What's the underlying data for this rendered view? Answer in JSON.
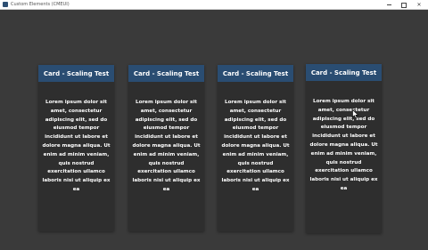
{
  "window": {
    "title": "Custom Elements (CMEUI)"
  },
  "cards": [
    {
      "header": "Card - Scaling Test",
      "body": "Lorem ipsum dolor sit amet, consectetur adipiscing elit, sed do eiusmod tempor incididunt ut labore et dolore magna aliqua. Ut enim ad minim veniam, quis nostrud exercitation ullamco laboris nisi ut aliquip ex ea"
    },
    {
      "header": "Card - Scaling Test",
      "body": "Lorem ipsum dolor sit amet, consectetur adipiscing elit, sed do eiusmod tempor incididunt ut labore et dolore magna aliqua. Ut enim ad minim veniam, quis nostrud exercitation ullamco laboris nisi ut aliquip ex ea"
    },
    {
      "header": "Card - Scaling Test",
      "body": "Lorem ipsum dolor sit amet, consectetur adipiscing elit, sed do eiusmod tempor incididunt ut labore et dolore magna aliqua. Ut enim ad minim veniam, quis nostrud exercitation ullamco laboris nisi ut aliquip ex ea"
    },
    {
      "header": "Card - Scaling Test",
      "body": "Lorem ipsum dolor sit amet, consectetur adipiscing elit, sed do eiusmod tempor incididunt ut labore et dolore magna aliqua. Ut enim ad minim veniam, quis nostrud exercitation ullamco laboris nisi ut aliquip ex ea"
    }
  ],
  "colors": {
    "background": "#3a3a3a",
    "card_body": "#2e2e2e",
    "card_header": "#2a4d72",
    "text": "#ffffff"
  },
  "icons": {
    "app": "app-icon",
    "minimize": "minimize-icon",
    "maximize": "maximize-icon",
    "close": "close-icon",
    "cursor": "mouse-cursor-icon"
  }
}
